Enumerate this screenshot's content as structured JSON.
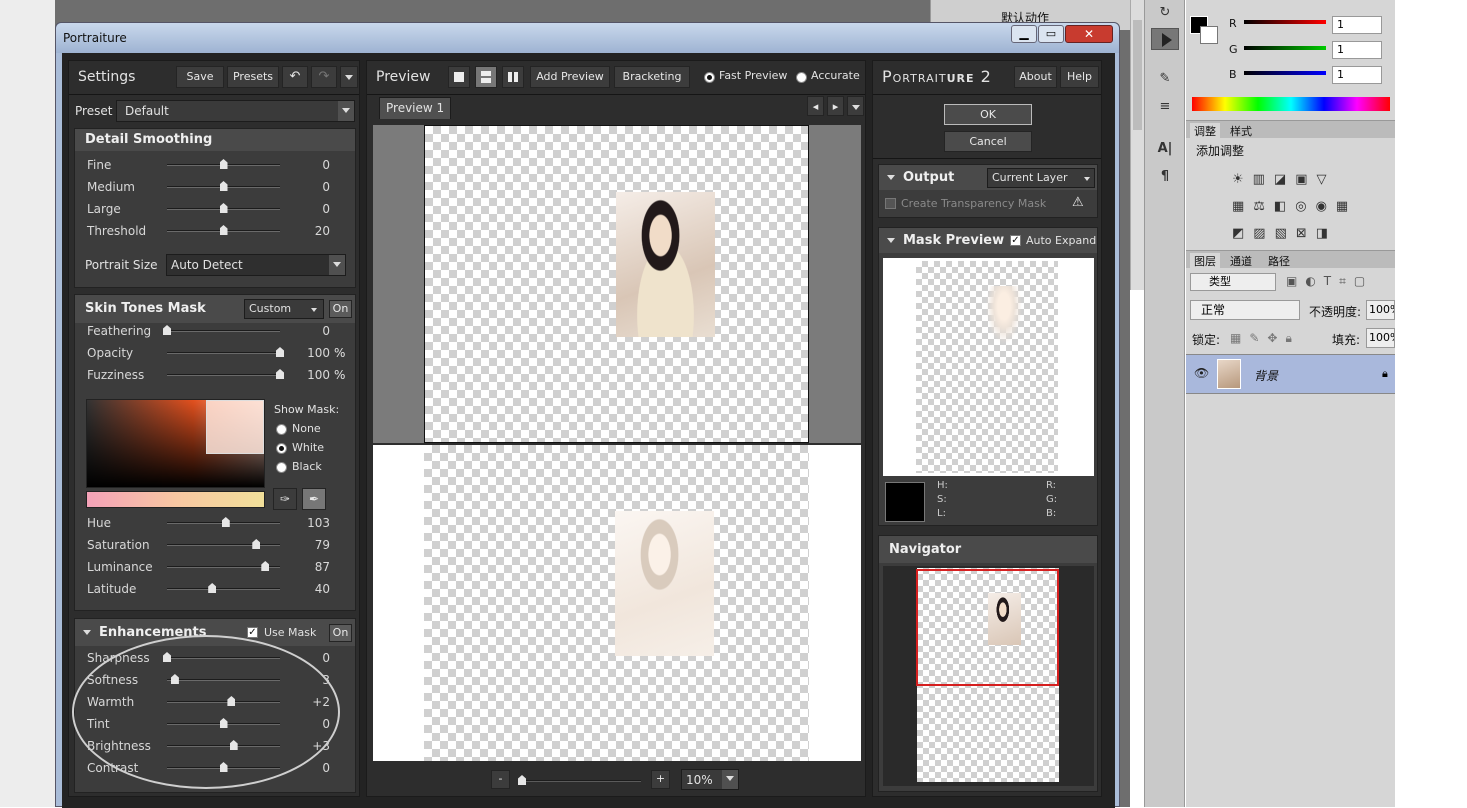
{
  "window": {
    "title": "Portraiture"
  },
  "settings": {
    "title": "Settings",
    "save": "Save",
    "presets": "Presets",
    "preset_label": "Preset",
    "preset_value": "Default",
    "detail": {
      "title": "Detail Smoothing",
      "rows": [
        {
          "label": "Fine",
          "value": "0",
          "pos": 0.5
        },
        {
          "label": "Medium",
          "value": "0",
          "pos": 0.5
        },
        {
          "label": "Large",
          "value": "0",
          "pos": 0.5
        },
        {
          "label": "Threshold",
          "value": "20",
          "pos": 0.5
        }
      ],
      "portrait_size_label": "Portrait Size",
      "portrait_size_value": "Auto Detect"
    },
    "skin": {
      "title": "Skin Tones Mask",
      "mode": "Custom",
      "on": "On",
      "rows": [
        {
          "label": "Feathering",
          "value": "0",
          "unit": "",
          "pos": 0.0
        },
        {
          "label": "Opacity",
          "value": "100",
          "unit": "%",
          "pos": 1.0
        },
        {
          "label": "Fuzziness",
          "value": "100",
          "unit": "%",
          "pos": 1.0
        }
      ],
      "show_mask": "Show Mask:",
      "mask_options": [
        "None",
        "White",
        "Black"
      ],
      "mask_selected": "White",
      "rows2": [
        {
          "label": "Hue",
          "value": "103",
          "pos": 0.52
        },
        {
          "label": "Saturation",
          "value": "79",
          "pos": 0.79
        },
        {
          "label": "Luminance",
          "value": "87",
          "pos": 0.87
        },
        {
          "label": "Latitude",
          "value": "40",
          "pos": 0.4
        }
      ]
    },
    "enh": {
      "title": "Enhancements",
      "use_mask": "Use Mask",
      "on": "On",
      "rows": [
        {
          "label": "Sharpness",
          "value": "0",
          "pos": 0.0
        },
        {
          "label": "Softness",
          "value": "3",
          "pos": 0.07
        },
        {
          "label": "Warmth",
          "value": "+2",
          "pos": 0.57
        },
        {
          "label": "Tint",
          "value": "0",
          "pos": 0.5
        },
        {
          "label": "Brightness",
          "value": "+3",
          "pos": 0.59
        },
        {
          "label": "Contrast",
          "value": "0",
          "pos": 0.5
        }
      ]
    }
  },
  "preview": {
    "title": "Preview",
    "add": "Add Preview",
    "bracketing": "Bracketing",
    "fast": "Fast Preview",
    "accurate": "Accurate",
    "tab": "Preview 1",
    "zoom": "10%",
    "minus": "-",
    "plus": "+"
  },
  "right": {
    "brand_a": "Portrait",
    "brand_b": "ure",
    "brand_num": "2",
    "about": "About",
    "help": "Help",
    "ok": "OK",
    "cancel": "Cancel",
    "output": "Output",
    "output_value": "Current Layer",
    "transparency": "Create Transparency Mask",
    "mask_preview": "Mask Preview",
    "auto_expand": "Auto Expand",
    "hsl": {
      "h": "H:",
      "s": "S:",
      "l": "L:",
      "r": "R:",
      "g": "G:",
      "b": "B:"
    },
    "navigator": "Navigator"
  },
  "ps": {
    "actions": "默认动作",
    "r": "R",
    "g": "G",
    "b": "B",
    "r_val": "1",
    "g_val": "1",
    "b_val": "1",
    "tab_adjust": "调整",
    "tab_style": "样式",
    "add_adjust": "添加调整",
    "tab_layers": "图层",
    "tab_channels": "通道",
    "tab_paths": "路径",
    "kind": "类型",
    "blend": "正常",
    "opacity_label": "不透明度:",
    "opacity_val": "100%",
    "lock": "锁定:",
    "fill_label": "填充:",
    "fill_val": "100%",
    "layer_name": "背景"
  },
  "colors": {
    "accent_red": "#d62020",
    "panel": "#2f2f2f",
    "header": "#4a4a4a"
  }
}
